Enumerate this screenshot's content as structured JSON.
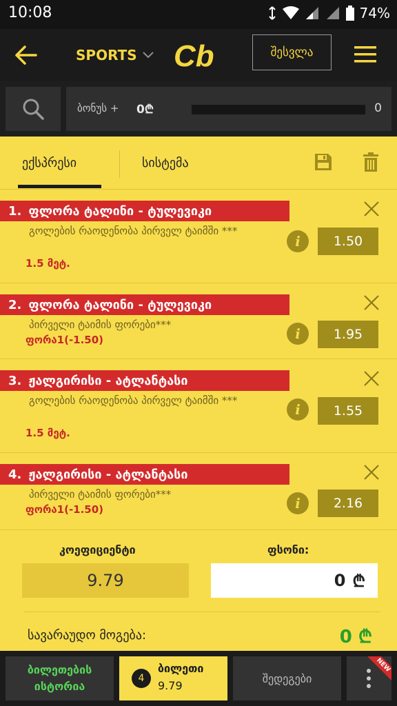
{
  "status": {
    "time": "10:08",
    "battery": "74%"
  },
  "header": {
    "sports_label": "SPORTS",
    "logo_text": "Cb",
    "login_label": "შესვლა"
  },
  "bonus": {
    "label": "ბონუს +",
    "value": "0₾",
    "count": "0"
  },
  "tabs": {
    "express": "ექსპრესი",
    "system": "სისტემა"
  },
  "bets": [
    {
      "num": "1.",
      "match": "ფლორა ტალინი - ტულევიკი",
      "market": "გოლების რაოდენობა პირველ ტაიმში ***",
      "outcome": "1.5 მეტ.",
      "odds": "1.50"
    },
    {
      "num": "2.",
      "match": "ფლორა ტალინი - ტულევიკი",
      "market": "პირველი ტაიმის ფორები***",
      "outcome": "ფორა1(-1.50)",
      "odds": "1.95"
    },
    {
      "num": "3.",
      "match": "ჟალგირისი - ატლანტასი",
      "market": "გოლების რაოდენობა პირველ ტაიმში ***",
      "outcome": "1.5 მეტ.",
      "odds": "1.55"
    },
    {
      "num": "4.",
      "match": "ჟალგირისი - ატლანტასი",
      "market": "პირველი ტაიმის ფორები***",
      "outcome": "ფორა1(-1.50)",
      "odds": "2.16"
    }
  ],
  "summary": {
    "coef_label": "კოეფიციენტი",
    "coef_value": "9.79",
    "stake_label": "ფსონი:",
    "stake_value": "0",
    "currency": "₾",
    "win_label": "სავარაუდო მოგება:",
    "win_value": "0 ₾"
  },
  "bottom": {
    "history_label": "ბილეთების ისტორია",
    "ticket_count": "4",
    "ticket_label": "ბილეთი",
    "ticket_total": "9.79",
    "checks_label": "შედეგები",
    "new_badge": "NEW"
  },
  "icons": {
    "info": "i"
  },
  "colors": {
    "background": "#f7dd4c",
    "accent_yellow": "#f5d641",
    "banner_red": "#d32b2b",
    "odds_box": "#a08d1c",
    "win_green": "#2b9e2b"
  }
}
